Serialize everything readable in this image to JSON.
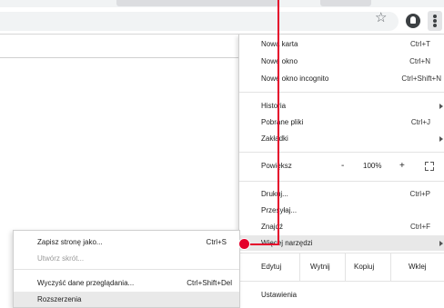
{
  "browser": {
    "icons": {
      "bookmark": "star-icon",
      "extension": "ghost-extension-icon",
      "menu": "vertical-dots-icon"
    },
    "star_glyph": "☆"
  },
  "main_menu": {
    "items": [
      {
        "label": "Nowa karta",
        "shortcut": "Ctrl+T"
      },
      {
        "label": "Nowe okno",
        "shortcut": "Ctrl+N"
      },
      {
        "label": "Nowe okno incognito",
        "shortcut": "Ctrl+Shift+N"
      },
      {
        "label": "Historia",
        "has_submenu": true
      },
      {
        "label": "Pobrane pliki",
        "shortcut": "Ctrl+J"
      },
      {
        "label": "Zakładki",
        "has_submenu": true
      },
      {
        "label": "Drukuj...",
        "shortcut": "Ctrl+P"
      },
      {
        "label": "Przesyłaj..."
      },
      {
        "label": "Znajdź",
        "shortcut": "Ctrl+F"
      },
      {
        "label": "Więcej narzędzi",
        "has_submenu": true,
        "highlighted": true
      },
      {
        "label": "Ustawienia"
      }
    ],
    "zoom": {
      "label": "Powiększ",
      "minus": "-",
      "value": "100%",
      "plus": "+"
    },
    "edit": {
      "label": "Edytuj",
      "cut": "Wytnij",
      "copy": "Kopiuj",
      "paste": "Wklej"
    }
  },
  "more_tools_submenu": {
    "items": [
      {
        "label": "Zapisz stronę jako...",
        "shortcut": "Ctrl+S"
      },
      {
        "label": "Utwórz skrót...",
        "disabled": true
      },
      {
        "label": "Wyczyść dane przeglądania...",
        "shortcut": "Ctrl+Shift+Del"
      },
      {
        "label": "Rozszerzenia",
        "highlighted": true
      }
    ]
  },
  "colors": {
    "annotation": "#e4002b",
    "highlight": "#e8e8e8",
    "toolbar_bg": "#f1f3f4"
  }
}
